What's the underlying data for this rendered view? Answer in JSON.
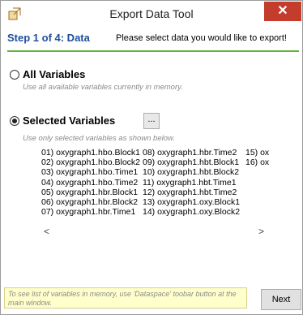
{
  "window": {
    "title": "Export Data Tool",
    "close_glyph": "✕"
  },
  "header": {
    "step": "Step 1 of 4: Data",
    "hint": "Please select data you would like to export!"
  },
  "options": {
    "all": {
      "label": "All Variables",
      "desc": "Use all available variables currently in memory."
    },
    "selected": {
      "label": "Selected Variables",
      "desc": "Use only selected variables as shown below.",
      "browse_label": "..."
    }
  },
  "variables": {
    "col1": [
      "01) oxygraph1.hbo.Block1",
      "02) oxygraph1.hbo.Block2",
      "03) oxygraph1.hbo.Time1",
      "04) oxygraph1.hbo.Time2",
      "05) oxygraph1.hbr.Block1",
      "06) oxygraph1.hbr.Block2",
      "07) oxygraph1.hbr.Time1"
    ],
    "col2": [
      "08) oxygraph1.hbr.Time2",
      "09) oxygraph1.hbt.Block1",
      "10) oxygraph1.hbt.Block2",
      "11) oxygraph1.hbt.Time1",
      "12) oxygraph1.hbt.Time2",
      "13) oxygraph1.oxy.Block1",
      "14) oxygraph1.oxy.Block2"
    ],
    "col3": [
      "15) ox",
      "16) ox"
    ]
  },
  "scroll": {
    "left": "<",
    "right": ">"
  },
  "footer": {
    "note": "To see list of variables in memory, use 'Dataspace' toobar button at the main window.",
    "next_label": "Next"
  },
  "colors": {
    "accent": "#1f4e9c",
    "rule": "#5fb23a",
    "close": "#c43c2b"
  }
}
